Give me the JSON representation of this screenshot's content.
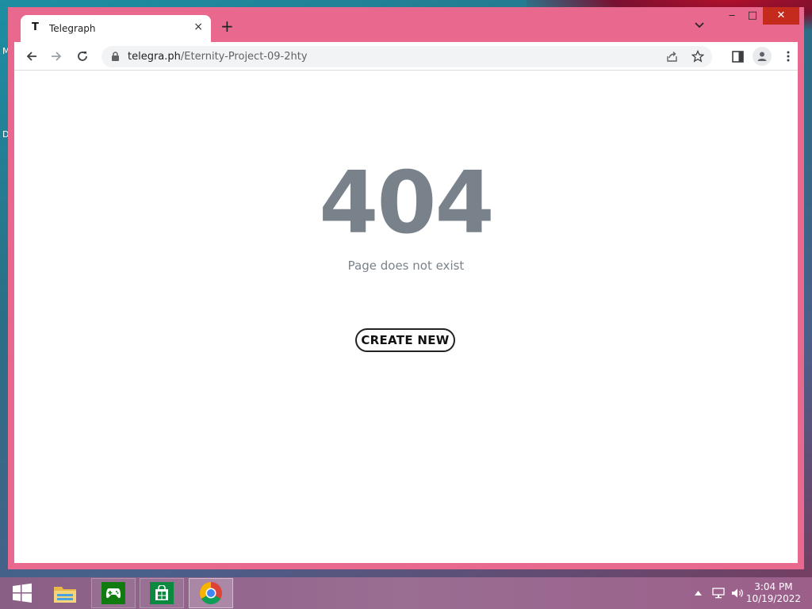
{
  "desktop": {
    "icon_labels": [
      "M",
      "D"
    ]
  },
  "browser": {
    "tab": {
      "favicon": "T",
      "title": "Telegraph",
      "close_icon": "×"
    },
    "new_tab_icon": "+",
    "tab_search_icon": "⌄",
    "window_controls": {
      "minimize": "‒",
      "maximize": "□",
      "close": "✕"
    },
    "url": {
      "host": "telegra.ph",
      "path": "/Eternity-Project-09-2hty"
    }
  },
  "page": {
    "code": "404",
    "message": "Page does not exist",
    "create_button": "CREATE NEW"
  },
  "taskbar": {
    "items": [
      "windows-start-icon",
      "file-explorer-icon",
      "xbox-games-icon",
      "store-icon",
      "chrome-icon"
    ],
    "clock": {
      "time": "3:04 PM",
      "date": "10/19/2022"
    }
  },
  "colors": {
    "window_frame": "#e8688e",
    "page_text": "#79828b",
    "close_red": "#c42b1c"
  }
}
